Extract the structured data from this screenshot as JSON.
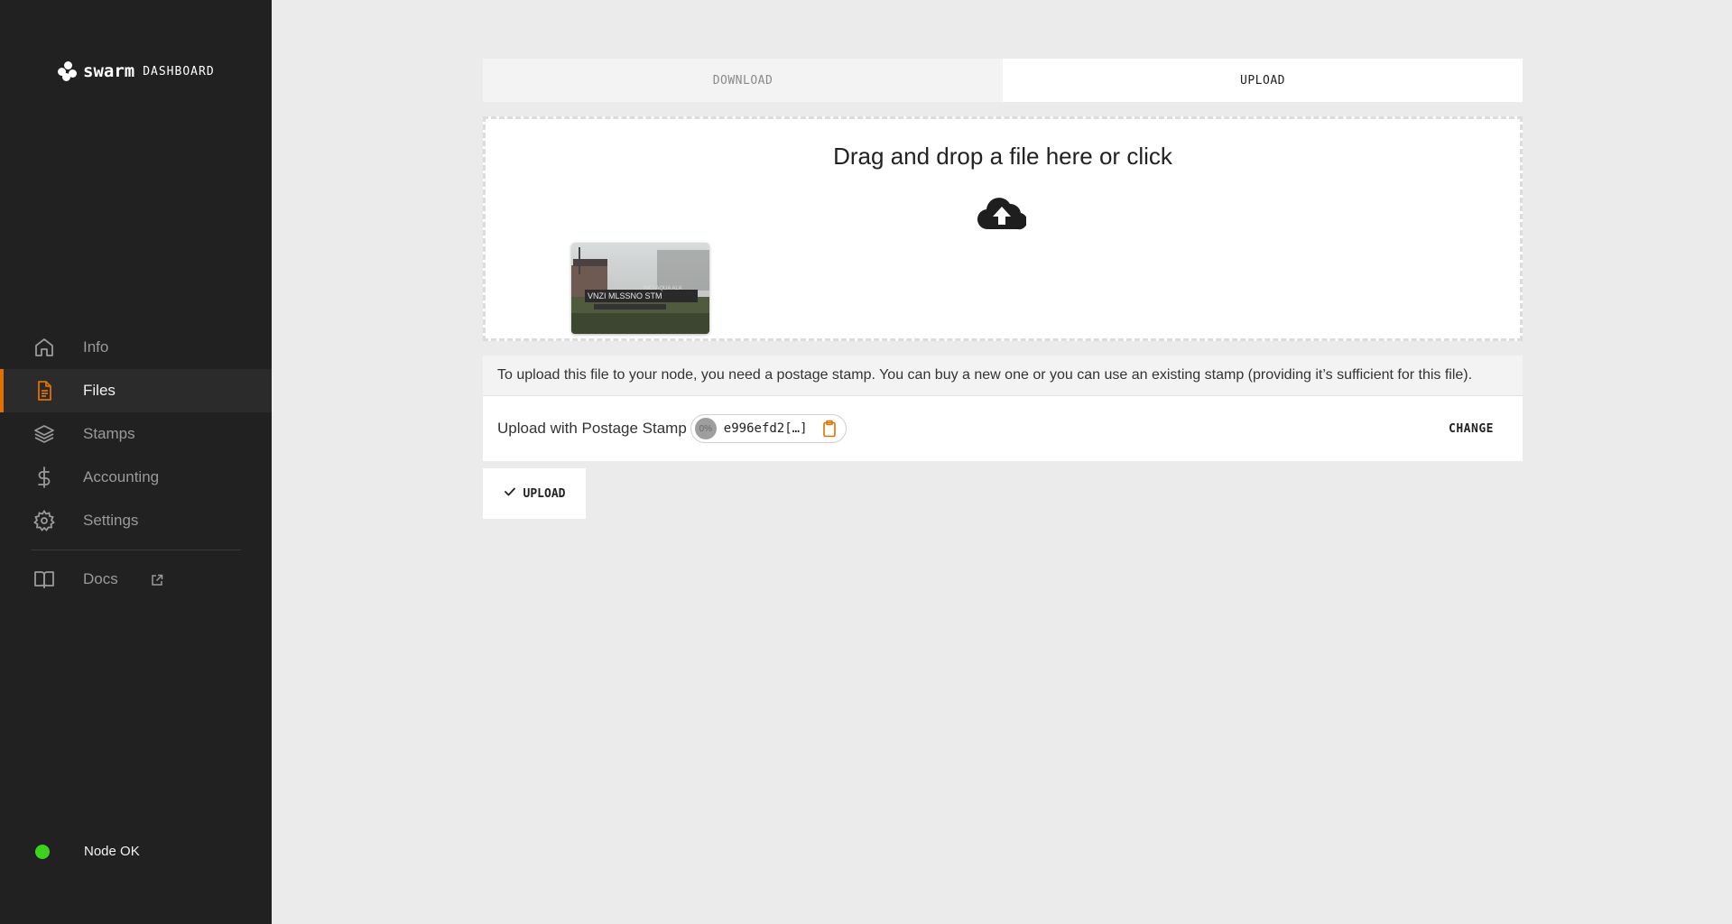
{
  "app": {
    "logo_word": "swarm",
    "logo_sub": "DASHBOARD"
  },
  "sidebar": {
    "items": [
      {
        "label": "Info",
        "icon": "home-icon",
        "active": false
      },
      {
        "label": "Files",
        "icon": "file-icon",
        "active": true
      },
      {
        "label": "Stamps",
        "icon": "layers-icon",
        "active": false
      },
      {
        "label": "Accounting",
        "icon": "dollar-icon",
        "active": false
      },
      {
        "label": "Settings",
        "icon": "gear-icon",
        "active": false
      }
    ],
    "docs": {
      "label": "Docs",
      "icon": "book-icon"
    },
    "status": {
      "label": "Node OK",
      "color": "#3cd31e"
    }
  },
  "tabs": {
    "download": "DOWNLOAD",
    "upload": "UPLOAD"
  },
  "dropzone": {
    "title": "Drag and drop a file here or click",
    "icon": "cloud-upload-icon"
  },
  "info": {
    "text": "To upload this file to your node, you need a postage stamp. You can buy a new one or you can use an existing stamp (providing it’s sufficient for this file)."
  },
  "stamp": {
    "label": "Upload with Postage Stamp",
    "usage": "0%",
    "id": "e996efd2[…]",
    "change_label": "CHANGE"
  },
  "upload_button": {
    "label": "UPLOAD"
  },
  "colors": {
    "accent": "#dd7200",
    "sidebar_bg": "#212121",
    "page_bg": "#ebebeb"
  }
}
